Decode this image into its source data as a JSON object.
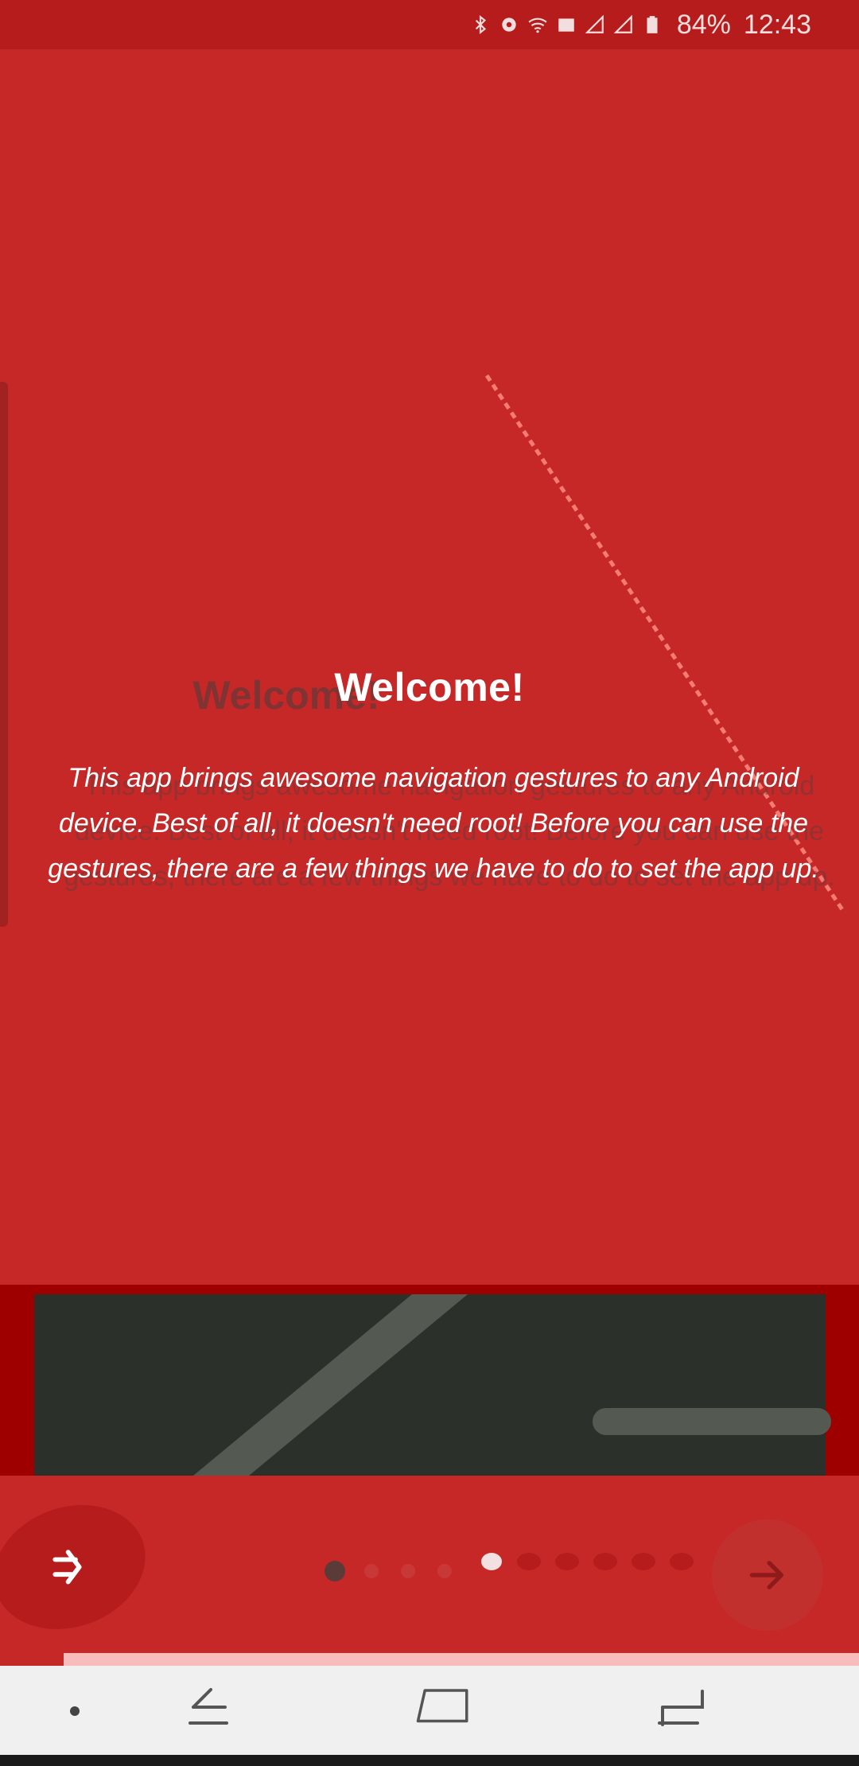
{
  "status_bar": {
    "battery_percent": "84%",
    "time": "12:43",
    "icons": [
      "bluetooth-icon",
      "gps-icon",
      "wifi-icon",
      "data-icon",
      "signal-icon-1",
      "signal-icon-2",
      "battery-icon"
    ]
  },
  "welcome": {
    "title": "Welcome!",
    "description": "This app brings awesome navigation gestures to any Android device. Best of all, it doesn't need root! Before you can use the gestures, there are a few things we have to do to set the app up."
  },
  "pager": {
    "total_pages": 6,
    "current_page": 1
  },
  "controls": {
    "skip_icon": "skip-arrow-icon",
    "next_icon": "next-arrow-icon"
  },
  "navigation_bar": {
    "icons": [
      "nav-dot-icon",
      "back-gesture-icon",
      "home-gesture-icon",
      "recents-gesture-icon"
    ]
  },
  "colors": {
    "background": "#c62828",
    "status_bar": "#b71c1c",
    "preview_frame": "#9e0000",
    "preview_screen": "#2c302b",
    "accent_pink": "#f8bcbc",
    "nav_bar": "#f0f0f0"
  }
}
